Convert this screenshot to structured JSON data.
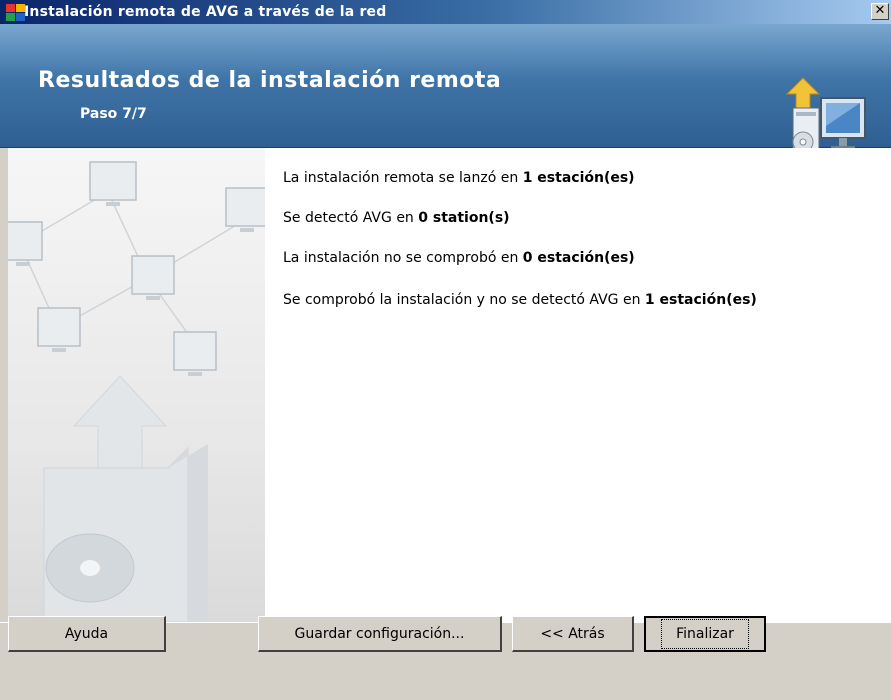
{
  "window": {
    "title": "Instalación remota de AVG a través de la red",
    "close_glyph": "✕"
  },
  "header": {
    "title": "Resultados de la instalación remota",
    "step": "Paso 7/7",
    "icon": "computer-install-icon"
  },
  "results": [
    {
      "prefix": "La instalación remota se lanzó en ",
      "count": "1 estación(es)"
    },
    {
      "prefix": "Se detectó AVG en ",
      "count": "0 station(s)"
    },
    {
      "prefix": "La instalación no se comprobó en ",
      "count": "0 estación(es)"
    },
    {
      "prefix": "Se comprobó la instalación y no se detectó AVG en ",
      "count": "1 estación(es)"
    }
  ],
  "buttons": {
    "help": "Ayuda",
    "save_config": "Guardar configuración...",
    "back": "<< Atrás",
    "finish": "Finalizar"
  },
  "colors": {
    "title_bar": "#0a246a",
    "header": "#3f74a7",
    "dialog_bg": "#d4d0c8"
  }
}
